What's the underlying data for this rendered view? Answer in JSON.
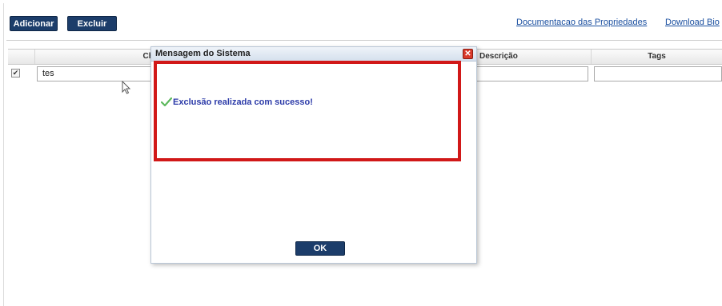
{
  "toolbar": {
    "add_label": "Adicionar",
    "delete_label": "Excluir"
  },
  "links": {
    "documentation": "Documentacao das Propriedades",
    "download": "Download Bio"
  },
  "grid": {
    "columns": [
      "Chave",
      "Descrição",
      "Tags"
    ],
    "rows": [
      {
        "checked": true,
        "chave": "tes",
        "descricao": "",
        "tags": ""
      }
    ]
  },
  "dialog": {
    "title": "Mensagem do Sistema",
    "message": "Exclusão realizada com sucesso!",
    "ok_label": "OK",
    "close_glyph": "✕"
  },
  "colors": {
    "button": "#1c3d6a",
    "link": "#1a4fa0",
    "highlight": "#d11818",
    "message": "#2b3aa8",
    "success_check": "#5cb85c"
  }
}
